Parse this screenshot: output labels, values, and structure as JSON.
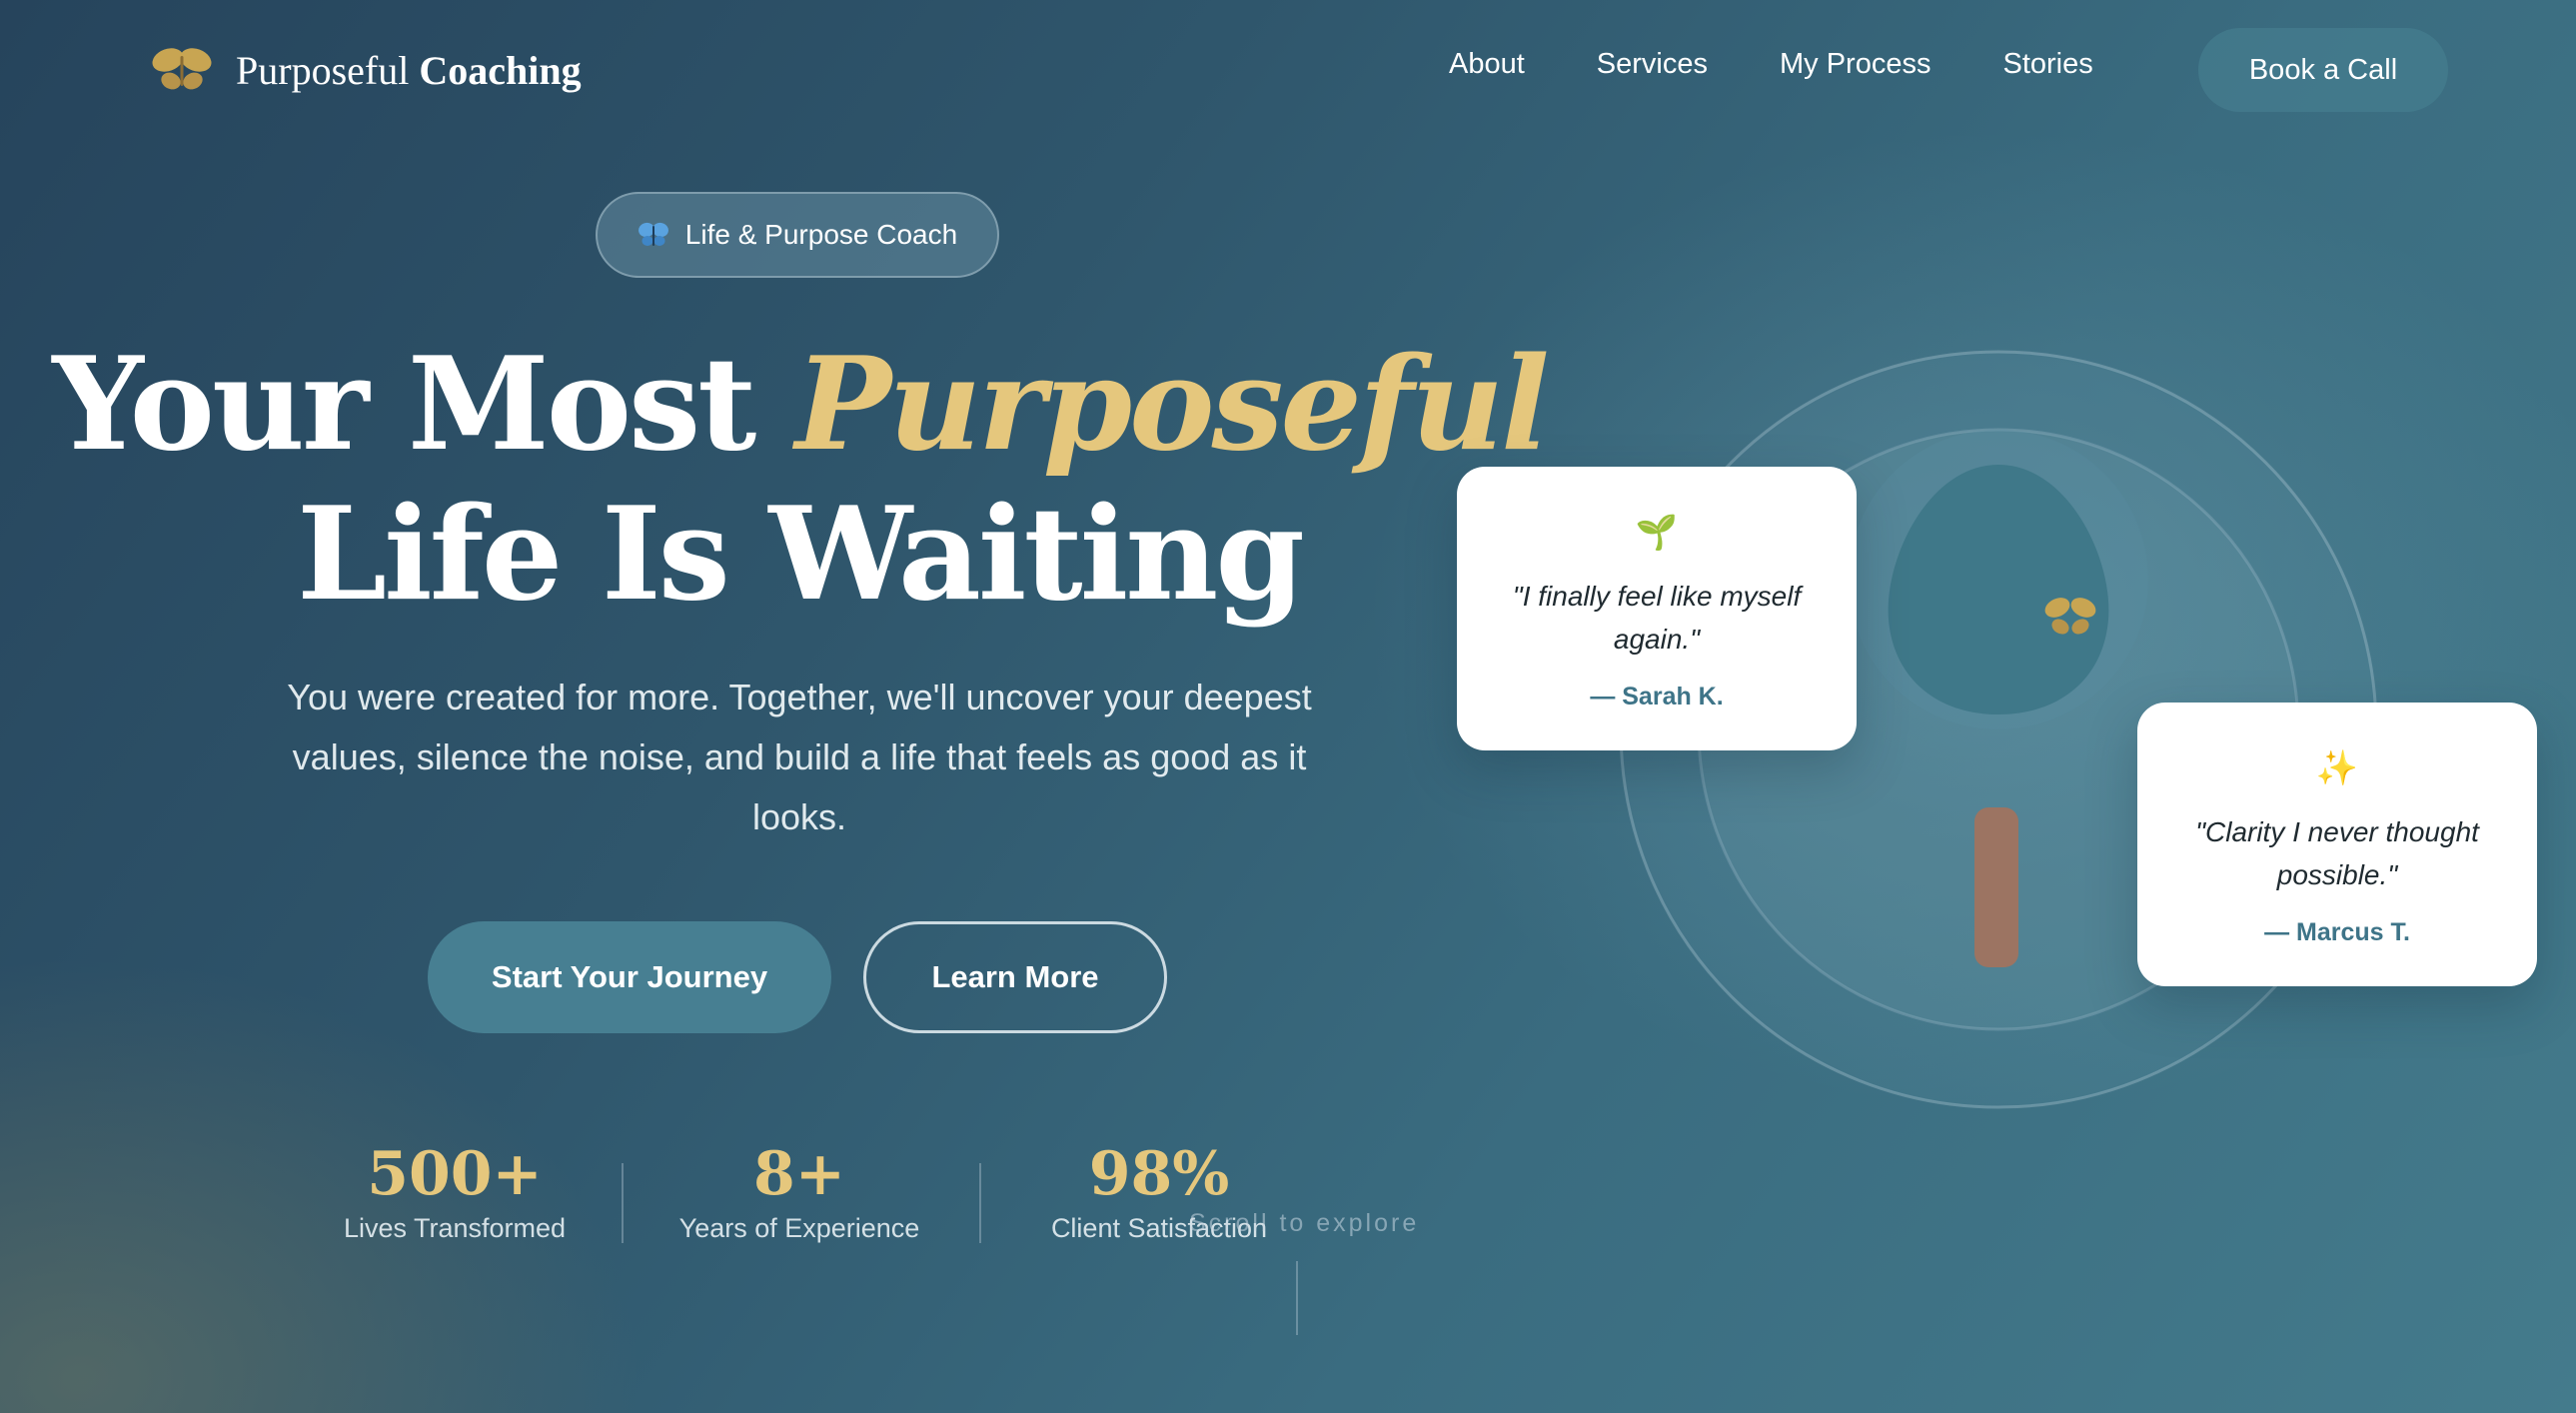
{
  "nav": {
    "brand_light": "Purposeful",
    "brand_bold": "Coaching",
    "links": [
      "About",
      "Services",
      "My Process",
      "Stories"
    ],
    "cta": "Book a Call"
  },
  "hero": {
    "badge": "Life & Purpose Coach",
    "title_part1": "Your Most",
    "title_accent": "Purposeful",
    "title_line2": "Life Is Waiting",
    "subtitle": "You were created for more. Together, we'll uncover your deepest values, silence the noise, and build a life that feels as good as it looks.",
    "primary_button": "Start Your Journey",
    "secondary_button": "Learn More"
  },
  "stats": [
    {
      "value": "500+",
      "label": "Lives Transformed"
    },
    {
      "value": "8+",
      "label": "Years of Experience"
    },
    {
      "value": "98%",
      "label": "Client Satisfaction"
    }
  ],
  "scroll_hint": "Scroll to explore",
  "testimonials": [
    {
      "icon": "seedling-icon",
      "glyph": "🌱",
      "quote": "\"I finally feel like myself again.\"",
      "author": "— Sarah K."
    },
    {
      "icon": "sparkles-icon",
      "glyph": "✨",
      "quote": "\"Clarity I never thought possible.\"",
      "author": "— Marcus T."
    }
  ],
  "colors": {
    "accent_gold": "#e5c77d",
    "primary_teal": "#477f92",
    "author_teal": "#3e7488"
  }
}
